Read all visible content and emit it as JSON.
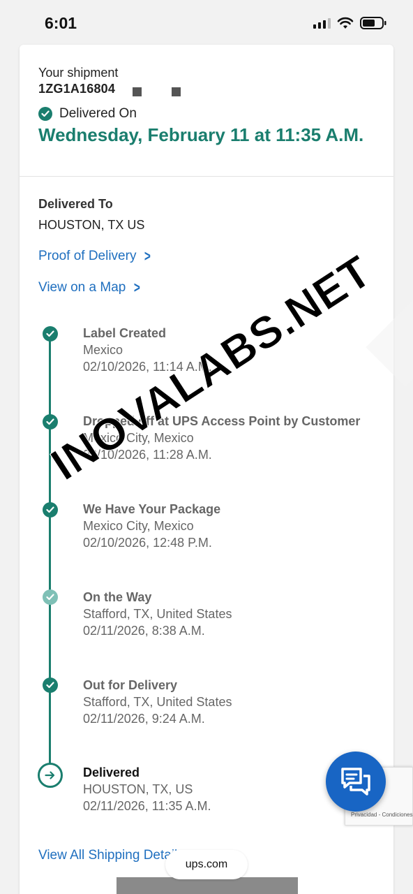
{
  "status_bar": {
    "time": "6:01"
  },
  "shipment": {
    "heading": "Your shipment",
    "tracking_number": "1ZG1A16804",
    "status_label": "Delivered On",
    "delivered_date": "Wednesday, February 11 at 11:35 A.M."
  },
  "delivery": {
    "delivered_to_label": "Delivered To",
    "delivered_to_value": "HOUSTON, TX US",
    "proof_link": "Proof of Delivery",
    "map_link": "View on a Map"
  },
  "timeline": [
    {
      "title": "Label Created",
      "location": "Mexico",
      "datetime": "02/10/2026, 11:14 A.M."
    },
    {
      "title": "Dropped off at UPS Access Point by Customer",
      "location": "Mexico City, Mexico",
      "datetime": "02/10/2026, 11:28 A.M."
    },
    {
      "title": "We Have Your Package",
      "location": "Mexico City, Mexico",
      "datetime": "02/10/2026, 12:48 P.M."
    },
    {
      "title": "On the Way",
      "location": "Stafford, TX, United States",
      "datetime": "02/11/2026, 8:38 A.M."
    },
    {
      "title": "Out for Delivery",
      "location": "Stafford, TX, United States",
      "datetime": "02/11/2026, 9:24 A.M."
    },
    {
      "title": "Delivered",
      "location": "HOUSTON, TX, US",
      "datetime": "02/11/2026, 11:35 A.M."
    }
  ],
  "view_all_link": "View All Shipping Details",
  "watermark": "INOVALABS.NET",
  "recaptcha": "Privacidad - Condiciones",
  "browser_url": "ups.com",
  "colors": {
    "accent": "#1a7e6e",
    "link": "#1f6fbf",
    "chat": "#1865c4"
  },
  "icons": [
    "check-circle-icon",
    "chevron-right-icon",
    "arrow-right-circle-icon",
    "chat-icon",
    "signal-icon",
    "wifi-icon",
    "battery-icon"
  ]
}
